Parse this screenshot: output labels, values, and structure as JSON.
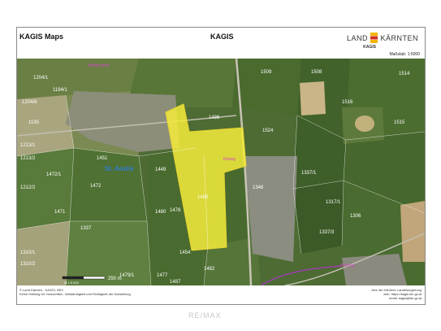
{
  "header": {
    "left_title": "KAGIS Maps",
    "center_title": "KAGIS",
    "logo_left": "LAND",
    "logo_right": "KÄRNTEN",
    "logo_sub": "KAGIS",
    "scale_label": "Maßstab: 1:5000"
  },
  "map": {
    "place_name": "St. Andrä",
    "highlight_color": "#f4ec3c",
    "scalebar": {
      "label": "250 m",
      "ratio": "M 1:5.000"
    },
    "place_markers": [
      "Eitweg",
      "Pichling",
      "Mettersdorf"
    ],
    "parcels": [
      "1204/1",
      "1204/8",
      "1194/1",
      "1195",
      "1213/1",
      "1213/2",
      "1212/2",
      "1472/1",
      "1471",
      "1472",
      "1337",
      "1310/1",
      "1310/2",
      "1478",
      "1477",
      "1486",
      "1485",
      "1480",
      "1479/1",
      "1482",
      "1509",
      "1508",
      "1514",
      "1515",
      "1516",
      "1524",
      "1306",
      "1317/1",
      "1337/3",
      "1337/1",
      "1346",
      "1449",
      "1451",
      "1454",
      "1487",
      "1481"
    ]
  },
  "footer": {
    "left_lines": [
      "© Land Kärnten - KAGIS, BEV",
      "Keine Haftung für Vorschriften, Vollständigkeit und Richtigkeit der Darstellung"
    ],
    "right_lines": [
      "Amt der Kärntner Landesregierung",
      "web: https://kagis.ktn.gv.at",
      "email: kagis@ktn.gv.at"
    ]
  },
  "watermark": "RE/MAX"
}
